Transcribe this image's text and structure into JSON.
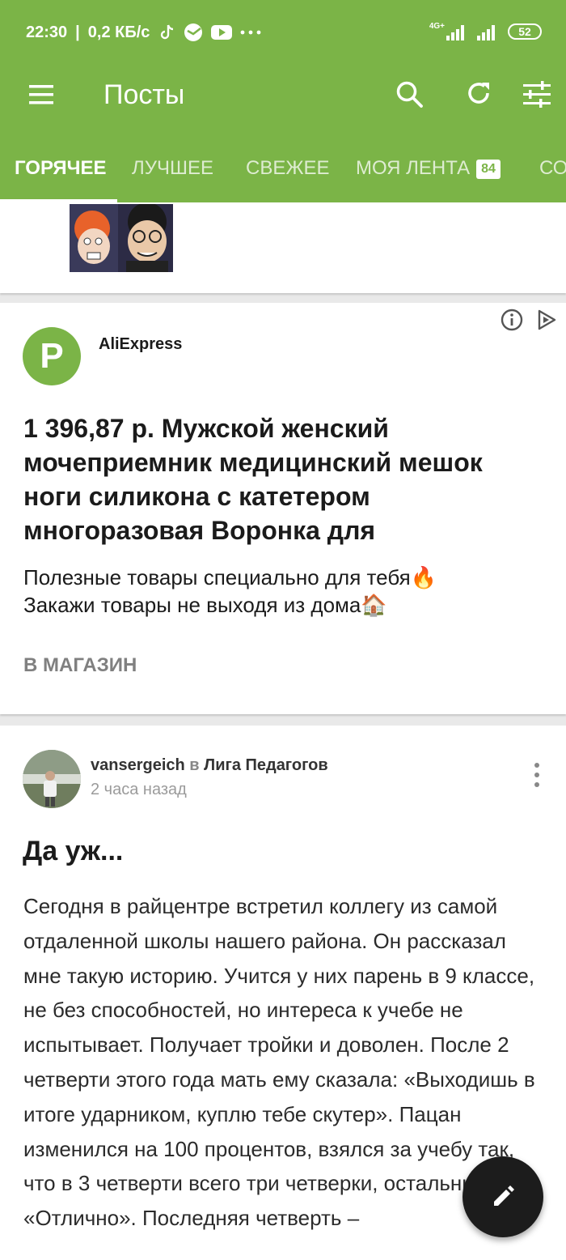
{
  "status_bar": {
    "time": "22:30",
    "speed": "0,2 КБ/с",
    "battery": "52",
    "network": "4G+",
    "icons": [
      "tiktok-icon",
      "sber-icon",
      "youtube-icon",
      "more-icon"
    ]
  },
  "app_bar": {
    "title": "Посты",
    "actions": [
      "search-icon",
      "refresh-icon",
      "filter-icon"
    ]
  },
  "tabs": [
    {
      "label": "ГОРЯЧЕЕ",
      "active": true
    },
    {
      "label": "ЛУЧШЕЕ"
    },
    {
      "label": "СВЕЖЕЕ"
    },
    {
      "label": "МОЯ ЛЕНТА",
      "badge": "84"
    },
    {
      "label": "СО"
    }
  ],
  "ad": {
    "avatar_letter": "P",
    "author": "AliExpress",
    "title": "1 396,87 р. Мужской женский мочеприемник медицинский мешок ноги силикона с катетером многоразовая Воронка для",
    "description_line1": "Полезные товары специально для тебя🔥",
    "description_line2": "Закажи товары не выходя из дома🏠",
    "link_label": "В МАГАЗИН"
  },
  "post": {
    "author": "vansergeich",
    "in_label": "в",
    "community": "Лига Педагогов",
    "time": "2 часа назад",
    "title": "Да уж...",
    "body": "Сегодня в райцентре встретил коллегу из самой отдаленной школы нашего района. Он рассказал мне такую историю. Учится у них парень в 9 классе, не без способностей, но интереса к учебе не испытывает. Получает тройки и доволен. После 2 четверти этого года мать ему сказала: «Выходишь в итоге ударником, куплю тебе скутер». Пацан изменился на 100 процентов, взялся за учебу так, что в 3 четверти всего три четверки, остальные «Отлично». Последняя четверть –"
  },
  "colors": {
    "brand": "#7bb447",
    "fab": "#1c1c1c"
  }
}
